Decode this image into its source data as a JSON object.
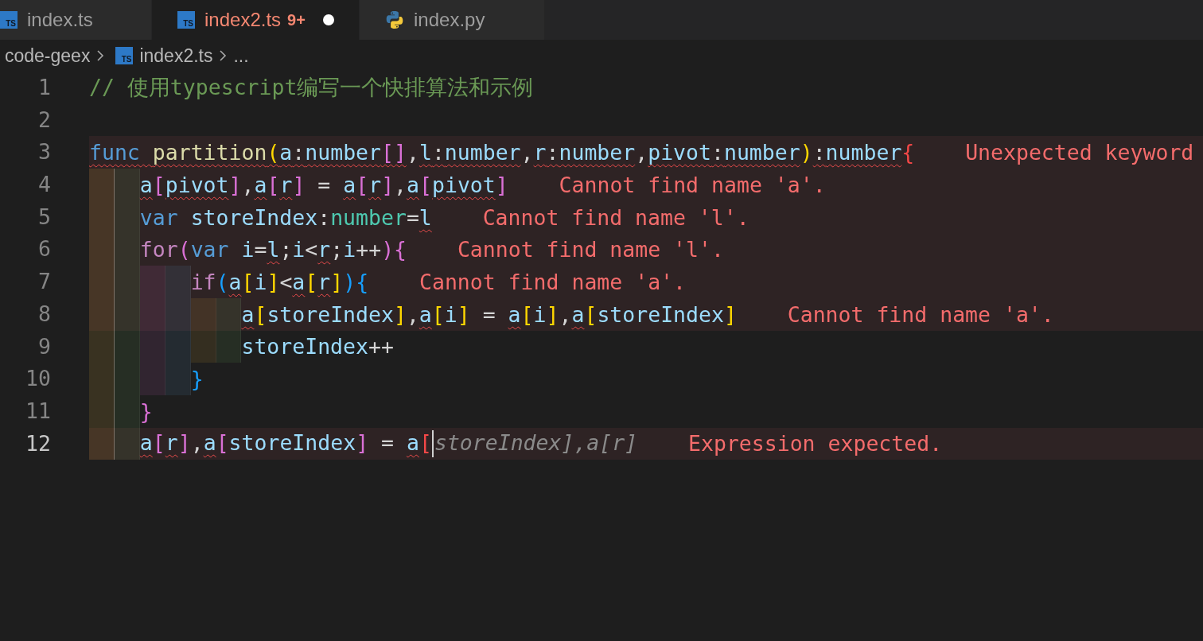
{
  "tabs": [
    {
      "label": "index.ts",
      "kind": "ts",
      "icon_text": "TS",
      "selected": false,
      "has_errors": false,
      "modified": false
    },
    {
      "label": "index2.ts",
      "kind": "ts",
      "icon_text": "TS",
      "selected": true,
      "has_errors": true,
      "problems": "9+",
      "modified": true
    },
    {
      "label": "index.py",
      "kind": "py",
      "selected": false,
      "has_errors": false,
      "modified": false
    }
  ],
  "breadcrumb": [
    {
      "label": "code-geex",
      "kind": "folder"
    },
    {
      "label": "index2.ts",
      "kind": "ts",
      "icon_text": "TS"
    },
    {
      "label": "...",
      "kind": "more"
    }
  ],
  "lines": [
    {
      "number": "1",
      "error": false,
      "active": false,
      "tokens": [
        {
          "text": "// 使用typescript编写一个快排算法和示例",
          "kind": "comment",
          "squiggle": false
        }
      ]
    },
    {
      "number": "2",
      "error": false,
      "active": false
    },
    {
      "number": "3",
      "error": true,
      "active": false,
      "message": "Unexpected keyword",
      "tokens": [
        {
          "text": "func ",
          "kind": "keyword",
          "squiggle": true
        },
        {
          "text": "partition",
          "kind": "function",
          "squiggle": true
        },
        {
          "text": "(",
          "kind": "bracket1",
          "squiggle": true
        },
        {
          "text": "a",
          "kind": "var",
          "squiggle": true
        },
        {
          "text": ":",
          "kind": "plain",
          "squiggle": true
        },
        {
          "text": "number",
          "kind": "var",
          "squiggle": true
        },
        {
          "text": "[]",
          "kind": "bracket2",
          "squiggle": true
        },
        {
          "text": ",",
          "kind": "plain",
          "squiggle": false
        },
        {
          "text": "l",
          "kind": "var",
          "squiggle": true
        },
        {
          "text": ":",
          "kind": "plain",
          "squiggle": true
        },
        {
          "text": "number",
          "kind": "var",
          "squiggle": true
        },
        {
          "text": ",",
          "kind": "plain",
          "squiggle": false
        },
        {
          "text": "r",
          "kind": "var",
          "squiggle": true
        },
        {
          "text": ":",
          "kind": "plain",
          "squiggle": true
        },
        {
          "text": "number",
          "kind": "var",
          "squiggle": true
        },
        {
          "text": ",",
          "kind": "plain",
          "squiggle": false
        },
        {
          "text": "pivot",
          "kind": "var",
          "squiggle": true
        },
        {
          "text": ":",
          "kind": "plain",
          "squiggle": true
        },
        {
          "text": "number",
          "kind": "var",
          "squiggle": true
        },
        {
          "text": ")",
          "kind": "bracket1",
          "squiggle": false
        },
        {
          "text": ":",
          "kind": "plain",
          "squiggle": true
        },
        {
          "text": "number",
          "kind": "var",
          "squiggle": true
        },
        {
          "text": "{",
          "kind": "errbracket",
          "squiggle": false
        }
      ],
      "children": [
        {
          "number": "4",
          "error": true,
          "active": false,
          "message": "Cannot find name 'a'.",
          "tokens": [
            {
              "text": "a",
              "kind": "var",
              "squiggle": true
            },
            {
              "text": "[",
              "kind": "bracket2",
              "squiggle": false
            },
            {
              "text": "pivot",
              "kind": "var",
              "squiggle": true
            },
            {
              "text": "]",
              "kind": "bracket2",
              "squiggle": false
            },
            {
              "text": ",",
              "kind": "plain",
              "squiggle": false
            },
            {
              "text": "a",
              "kind": "var",
              "squiggle": true
            },
            {
              "text": "[",
              "kind": "bracket2",
              "squiggle": false
            },
            {
              "text": "r",
              "kind": "var",
              "squiggle": true
            },
            {
              "text": "]",
              "kind": "bracket2",
              "squiggle": false
            },
            {
              "text": " = ",
              "kind": "plain",
              "squiggle": false
            },
            {
              "text": "a",
              "kind": "var",
              "squiggle": true
            },
            {
              "text": "[",
              "kind": "bracket2",
              "squiggle": false
            },
            {
              "text": "r",
              "kind": "var",
              "squiggle": true
            },
            {
              "text": "]",
              "kind": "bracket2",
              "squiggle": false
            },
            {
              "text": ",",
              "kind": "plain",
              "squiggle": false
            },
            {
              "text": "a",
              "kind": "var",
              "squiggle": true
            },
            {
              "text": "[",
              "kind": "bracket2",
              "squiggle": false
            },
            {
              "text": "pivot",
              "kind": "var",
              "squiggle": true
            },
            {
              "text": "]",
              "kind": "bracket2",
              "squiggle": false
            }
          ]
        },
        {
          "number": "5",
          "error": true,
          "active": false,
          "message": "Cannot find name 'l'.",
          "tokens": [
            {
              "text": "var ",
              "kind": "keyword",
              "squiggle": false
            },
            {
              "text": "storeIndex",
              "kind": "var",
              "squiggle": false
            },
            {
              "text": ":",
              "kind": "plain",
              "squiggle": false
            },
            {
              "text": "number",
              "kind": "type",
              "squiggle": false
            },
            {
              "text": "=",
              "kind": "plain",
              "squiggle": false
            },
            {
              "text": "l",
              "kind": "var",
              "squiggle": true
            }
          ]
        },
        {
          "number": "6",
          "error": true,
          "active": false,
          "message": "Cannot find name 'l'.",
          "tokens": [
            {
              "text": "for",
              "kind": "control",
              "squiggle": false
            },
            {
              "text": "(",
              "kind": "bracket2",
              "squiggle": false
            },
            {
              "text": "var ",
              "kind": "keyword",
              "squiggle": false
            },
            {
              "text": "i",
              "kind": "var",
              "squiggle": false
            },
            {
              "text": "=",
              "kind": "plain",
              "squiggle": false
            },
            {
              "text": "l",
              "kind": "var",
              "squiggle": true
            },
            {
              "text": ";",
              "kind": "plain",
              "squiggle": false
            },
            {
              "text": "i",
              "kind": "var",
              "squiggle": false
            },
            {
              "text": "<",
              "kind": "plain",
              "squiggle": false
            },
            {
              "text": "r",
              "kind": "var",
              "squiggle": true
            },
            {
              "text": ";",
              "kind": "plain",
              "squiggle": false
            },
            {
              "text": "i",
              "kind": "var",
              "squiggle": false
            },
            {
              "text": "++",
              "kind": "plain",
              "squiggle": false
            },
            {
              "text": ")",
              "kind": "bracket2",
              "squiggle": false
            },
            {
              "text": "{",
              "kind": "bracket2",
              "squiggle": false
            }
          ],
          "children": [
            {
              "number": "7",
              "error": true,
              "active": false,
              "message": "Cannot find name 'a'.",
              "tokens": [
                {
                  "text": "if",
                  "kind": "control",
                  "squiggle": false
                },
                {
                  "text": "(",
                  "kind": "bracket3",
                  "squiggle": false
                },
                {
                  "text": "a",
                  "kind": "var",
                  "squiggle": true
                },
                {
                  "text": "[",
                  "kind": "bracket1",
                  "squiggle": false
                },
                {
                  "text": "i",
                  "kind": "var",
                  "squiggle": false
                },
                {
                  "text": "]",
                  "kind": "bracket1",
                  "squiggle": false
                },
                {
                  "text": "<",
                  "kind": "plain",
                  "squiggle": false
                },
                {
                  "text": "a",
                  "kind": "var",
                  "squiggle": true
                },
                {
                  "text": "[",
                  "kind": "bracket1",
                  "squiggle": false
                },
                {
                  "text": "r",
                  "kind": "var",
                  "squiggle": true
                },
                {
                  "text": "]",
                  "kind": "bracket1",
                  "squiggle": false
                },
                {
                  "text": ")",
                  "kind": "bracket3",
                  "squiggle": false
                },
                {
                  "text": "{",
                  "kind": "bracket3",
                  "squiggle": false
                }
              ],
              "children": [
                {
                  "number": "8",
                  "error": true,
                  "active": false,
                  "message": "Cannot find name 'a'.",
                  "tokens": [
                    {
                      "text": "a",
                      "kind": "var",
                      "squiggle": true
                    },
                    {
                      "text": "[",
                      "kind": "bracket1",
                      "squiggle": false
                    },
                    {
                      "text": "storeIndex",
                      "kind": "var",
                      "squiggle": false
                    },
                    {
                      "text": "]",
                      "kind": "bracket1",
                      "squiggle": false
                    },
                    {
                      "text": ",",
                      "kind": "plain",
                      "squiggle": false
                    },
                    {
                      "text": "a",
                      "kind": "var",
                      "squiggle": true
                    },
                    {
                      "text": "[",
                      "kind": "bracket1",
                      "squiggle": false
                    },
                    {
                      "text": "i",
                      "kind": "var",
                      "squiggle": false
                    },
                    {
                      "text": "]",
                      "kind": "bracket1",
                      "squiggle": false
                    },
                    {
                      "text": " = ",
                      "kind": "plain",
                      "squiggle": false
                    },
                    {
                      "text": "a",
                      "kind": "var",
                      "squiggle": true
                    },
                    {
                      "text": "[",
                      "kind": "bracket1",
                      "squiggle": false
                    },
                    {
                      "text": "i",
                      "kind": "var",
                      "squiggle": false
                    },
                    {
                      "text": "]",
                      "kind": "bracket1",
                      "squiggle": false
                    },
                    {
                      "text": ",",
                      "kind": "plain",
                      "squiggle": false
                    },
                    {
                      "text": "a",
                      "kind": "var",
                      "squiggle": true
                    },
                    {
                      "text": "[",
                      "kind": "bracket1",
                      "squiggle": false
                    },
                    {
                      "text": "storeIndex",
                      "kind": "var",
                      "squiggle": false
                    },
                    {
                      "text": "]",
                      "kind": "bracket1",
                      "squiggle": false
                    }
                  ]
                },
                {
                  "number": "9",
                  "error": false,
                  "active": false,
                  "tokens": [
                    {
                      "text": "storeIndex",
                      "kind": "var",
                      "squiggle": false
                    },
                    {
                      "text": "++",
                      "kind": "plain",
                      "squiggle": false
                    }
                  ]
                }
              ]
            },
            {
              "number": "10",
              "error": false,
              "active": false,
              "tokens": [
                {
                  "text": "}",
                  "kind": "bracket3",
                  "squiggle": false
                }
              ]
            }
          ]
        },
        {
          "number": "11",
          "error": false,
          "active": false,
          "tokens": [
            {
              "text": "}",
              "kind": "bracket2",
              "squiggle": false
            }
          ]
        },
        {
          "number": "12",
          "error": true,
          "active": true,
          "message": "Expression expected.",
          "tokens": [
            {
              "text": "a",
              "kind": "var",
              "squiggle": true
            },
            {
              "text": "[",
              "kind": "bracket2",
              "squiggle": false
            },
            {
              "text": "r",
              "kind": "var",
              "squiggle": true
            },
            {
              "text": "]",
              "kind": "bracket2",
              "squiggle": false
            },
            {
              "text": ",",
              "kind": "plain",
              "squiggle": false
            },
            {
              "text": "a",
              "kind": "var",
              "squiggle": true
            },
            {
              "text": "[",
              "kind": "bracket2",
              "squiggle": false
            },
            {
              "text": "storeIndex",
              "kind": "var",
              "squiggle": false
            },
            {
              "text": "]",
              "kind": "bracket2",
              "squiggle": false
            },
            {
              "text": " = ",
              "kind": "plain",
              "squiggle": false
            },
            {
              "text": "a",
              "kind": "var",
              "squiggle": true
            },
            {
              "text": "[",
              "kind": "errbracket",
              "squiggle": false
            },
            {
              "text": "storeIndex],a[r]",
              "kind": "ghost",
              "squiggle": false
            }
          ]
        }
      ]
    }
  ]
}
